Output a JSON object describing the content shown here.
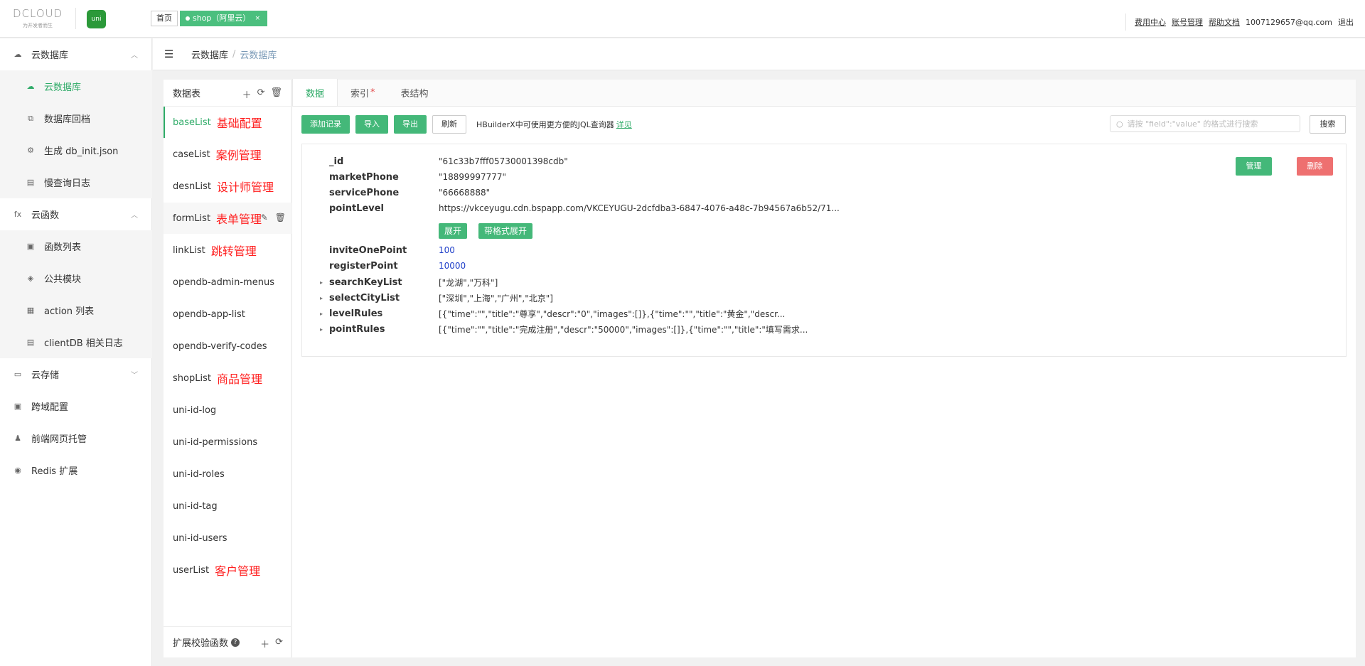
{
  "topbar": {
    "logo_text": "DCLOUD",
    "logo_sub": "为开发者而生",
    "uni_icon": "uni",
    "tab_home": "首页",
    "tab_active": "shop（阿里云）",
    "tab_close": "×",
    "links": [
      "费用中心",
      "账号管理",
      "帮助文档"
    ],
    "account": "1007129657@qq.com",
    "logout": "退出"
  },
  "sidebar": {
    "items": [
      {
        "label": "云数据库",
        "icon": "cloud-db-icon",
        "chevron": "^"
      },
      {
        "label": "云数据库",
        "icon": "cloud-db-icon"
      },
      {
        "label": "数据库回档",
        "icon": "db-backup-icon"
      },
      {
        "label": "生成 db_init.json",
        "icon": "generate-icon"
      },
      {
        "label": "慢查询日志",
        "icon": "log-icon"
      },
      {
        "label": "云函数",
        "icon": "fx-icon",
        "chevron": "^"
      },
      {
        "label": "函数列表",
        "icon": "function-list-icon"
      },
      {
        "label": "公共模块",
        "icon": "cube-icon"
      },
      {
        "label": "action 列表",
        "icon": "action-icon"
      },
      {
        "label": "clientDB 相关日志",
        "icon": "log-icon"
      },
      {
        "label": "云存储",
        "icon": "storage-icon",
        "chevron": "v"
      },
      {
        "label": "跨域配置",
        "icon": "cors-icon"
      },
      {
        "label": "前端网页托管",
        "icon": "hosting-icon"
      },
      {
        "label": "Redis 扩展",
        "icon": "redis-icon"
      }
    ]
  },
  "breadcrumb": {
    "first": "云数据库",
    "separator": "/",
    "current": "云数据库"
  },
  "tables_panel": {
    "title": "数据表",
    "list": [
      {
        "name": "baseList",
        "note": "基础配置"
      },
      {
        "name": "caseList",
        "note": "案例管理"
      },
      {
        "name": "desnList",
        "note": "设计师管理"
      },
      {
        "name": "formList",
        "note": "表单管理"
      },
      {
        "name": "linkList",
        "note": "跳转管理"
      },
      {
        "name": "opendb-admin-menus",
        "note": ""
      },
      {
        "name": "opendb-app-list",
        "note": ""
      },
      {
        "name": "opendb-verify-codes",
        "note": ""
      },
      {
        "name": "shopList",
        "note": "商品管理"
      },
      {
        "name": "uni-id-log",
        "note": ""
      },
      {
        "name": "uni-id-permissions",
        "note": ""
      },
      {
        "name": "uni-id-roles",
        "note": ""
      },
      {
        "name": "uni-id-tag",
        "note": ""
      },
      {
        "name": "uni-id-users",
        "note": ""
      },
      {
        "name": "userList",
        "note": "客户管理"
      }
    ],
    "footer": "扩展校验函数",
    "footer_help": "?"
  },
  "main": {
    "tabs": [
      {
        "label": "数据",
        "star": ""
      },
      {
        "label": "索引",
        "star": "*"
      },
      {
        "label": "表结构",
        "star": ""
      }
    ],
    "toolbar": {
      "add": "添加记录",
      "import": "导入",
      "export": "导出",
      "refresh": "刷新",
      "hint": "HBuilderX中可使用更方便的JQL查询器",
      "hint_link": "详见",
      "search_placeholder": "请按 \"field\":\"value\" 的格式进行搜索",
      "search_button": "搜索"
    },
    "record": {
      "manage": "管理",
      "delete": "删除",
      "expand": "展开",
      "expand_formatted": "带格式展开",
      "fields": [
        {
          "key": "_id",
          "value": "\"61c33b7fff05730001398cdb\"",
          "arrow": ""
        },
        {
          "key": "marketPhone",
          "value": "\"18899997777\"",
          "arrow": ""
        },
        {
          "key": "servicePhone",
          "value": "\"66668888\"",
          "arrow": ""
        },
        {
          "key": "pointLevel",
          "value": "https://vkceyugu.cdn.bspapp.com/VKCEYUGU-2dcfdba3-6847-4076-a48c-7b94567a6b52/71...",
          "arrow": ""
        },
        {
          "key": "inviteOnePoint",
          "value": "100",
          "arrow": ""
        },
        {
          "key": "registerPoint",
          "value": "10000",
          "arrow": ""
        },
        {
          "key": "searchKeyList",
          "value": "[\"龙湖\",\"万科\"]",
          "arrow": "▸"
        },
        {
          "key": "selectCityList",
          "value": "[\"深圳\",\"上海\",\"广州\",\"北京\"]",
          "arrow": "▸"
        },
        {
          "key": "levelRules",
          "value": "[{\"time\":\"\",\"title\":\"尊享\",\"descr\":\"0\",\"images\":[]},{\"time\":\"\",\"title\":\"黄金\",\"descr...",
          "arrow": "▸"
        },
        {
          "key": "pointRules",
          "value": "[{\"time\":\"\",\"title\":\"完成注册\",\"descr\":\"50000\",\"images\":[]},{\"time\":\"\",\"title\":\"填写需求...",
          "arrow": "▸"
        }
      ]
    }
  }
}
